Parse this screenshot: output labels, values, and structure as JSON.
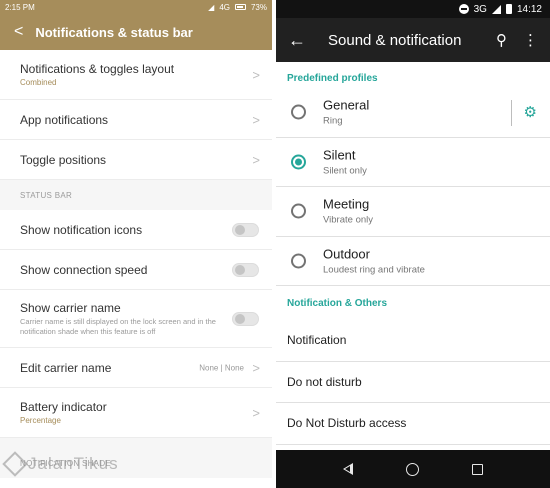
{
  "left": {
    "status_bar": {
      "time": "2:15 PM",
      "network": "4G",
      "battery": "73%"
    },
    "header": {
      "title": "Notifications & status bar"
    },
    "rows_top": [
      {
        "title": "Notifications & toggles layout",
        "subtitle": "Combined"
      },
      {
        "title": "App notifications"
      },
      {
        "title": "Toggle positions"
      }
    ],
    "section_status_bar": "STATUS BAR",
    "toggles": [
      {
        "title": "Show notification icons",
        "state": "off"
      },
      {
        "title": "Show connection speed",
        "state": "off"
      },
      {
        "title": "Show carrier name",
        "description": "Carrier name is still displayed on the lock screen and in the notification shade when this feature is off",
        "state": "off"
      }
    ],
    "edit_carrier": {
      "title": "Edit carrier name",
      "value": "None | None"
    },
    "battery": {
      "title": "Battery indicator",
      "subtitle": "Percentage"
    },
    "section_notification_shade": "NOTIFICATION SHADE",
    "accent_color": "#a68d5b"
  },
  "watermark": "JalanTikus",
  "right": {
    "status_bar": {
      "network": "3G",
      "time": "14:12"
    },
    "app_bar": {
      "title": "Sound & notification"
    },
    "section_profiles": "Predefined profiles",
    "profiles": [
      {
        "title": "General",
        "subtitle": "Ring",
        "selected": false
      },
      {
        "title": "Silent",
        "subtitle": "Silent only",
        "selected": true
      },
      {
        "title": "Meeting",
        "subtitle": "Vibrate only",
        "selected": false
      },
      {
        "title": "Outdoor",
        "subtitle": "Loudest ring and vibrate",
        "selected": false
      }
    ],
    "section_others": "Notification & Others",
    "rows": [
      {
        "title": "Notification"
      },
      {
        "title": "Do not disturb"
      },
      {
        "title": "Do Not Disturb access"
      }
    ],
    "accent_color": "#26a69a"
  }
}
